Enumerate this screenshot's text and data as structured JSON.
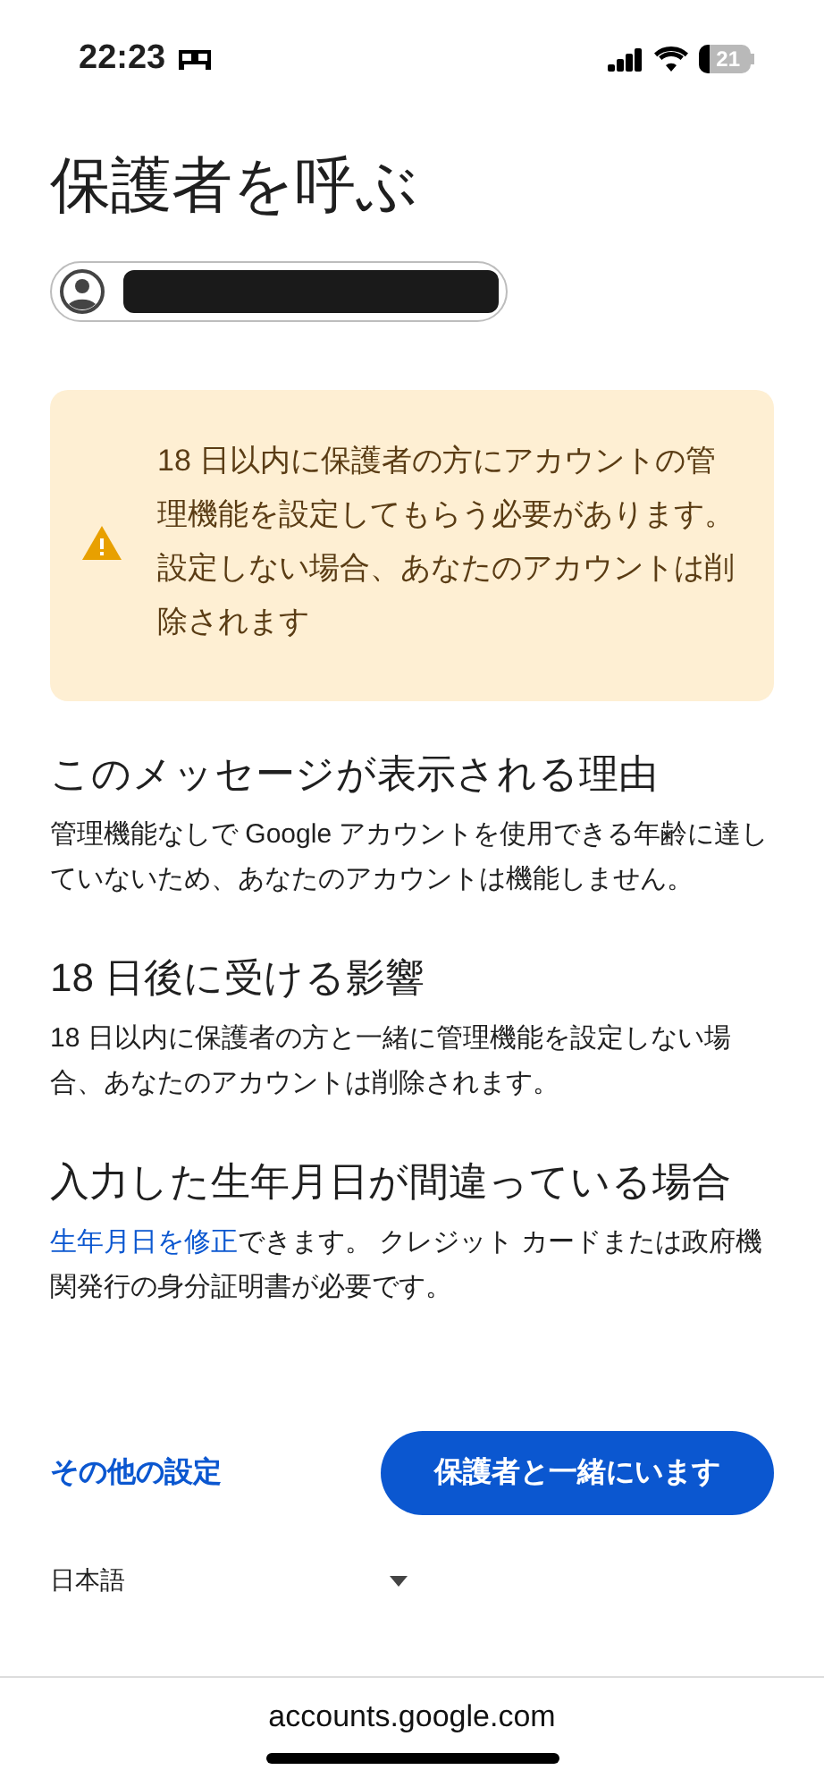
{
  "status_bar": {
    "time": "22:23",
    "battery": "21"
  },
  "title": "保護者を呼ぶ",
  "account": {
    "redacted": true
  },
  "warning": {
    "text": "18 日以内に保護者の方にアカウントの管理機能を設定してもらう必要があります。設定しない場合、あなたのアカウントは削除されます"
  },
  "sections": [
    {
      "heading": "このメッセージが表示される理由",
      "body": "管理機能なしで Google アカウントを使用できる年齢に達していないため、あなたのアカウントは機能しません。"
    },
    {
      "heading": "18 日後に受ける影響",
      "body": "18 日以内に保護者の方と一緒に管理機能を設定しない場合、あなたのアカウントは削除されます。"
    },
    {
      "heading": "入力した生年月日が間違っている場合",
      "link": "生年月日を修正",
      "body": "できます。 クレジット カードまたは政府機関発行の身分証明書が必要です。"
    }
  ],
  "actions": {
    "secondary": "その他の設定",
    "primary": "保護者と一緒にいます"
  },
  "language": "日本語",
  "browser_bar": {
    "url": "accounts.google.com"
  }
}
